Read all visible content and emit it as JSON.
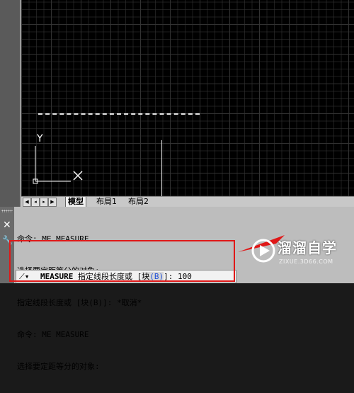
{
  "canvas": {
    "ucs_y_label": "Y"
  },
  "tabs": {
    "items": [
      {
        "label": "模型",
        "active": true
      },
      {
        "label": "布局1",
        "active": false
      },
      {
        "label": "布局2",
        "active": false
      }
    ]
  },
  "command": {
    "history": [
      "命令: ME MEASURE",
      "选择要定距等分的对象:",
      "指定线段长度或 [块(B)]: *取消*",
      "命令: ME MEASURE",
      "选择要定距等分的对象:"
    ],
    "prompt": {
      "command_name": "MEASURE",
      "text_before": " 指定线段长度或 [",
      "keyword": "块(B)",
      "keyword_text": "块",
      "keyword_key": "(B)",
      "text_after": "]: ",
      "input_value": "100"
    }
  },
  "watermark": {
    "title": "溜溜自学",
    "subtitle": "ZIXUE.3D66.COM"
  },
  "colors": {
    "highlight_box": "#e01818",
    "keyword_blue": "#1f4fd8"
  }
}
